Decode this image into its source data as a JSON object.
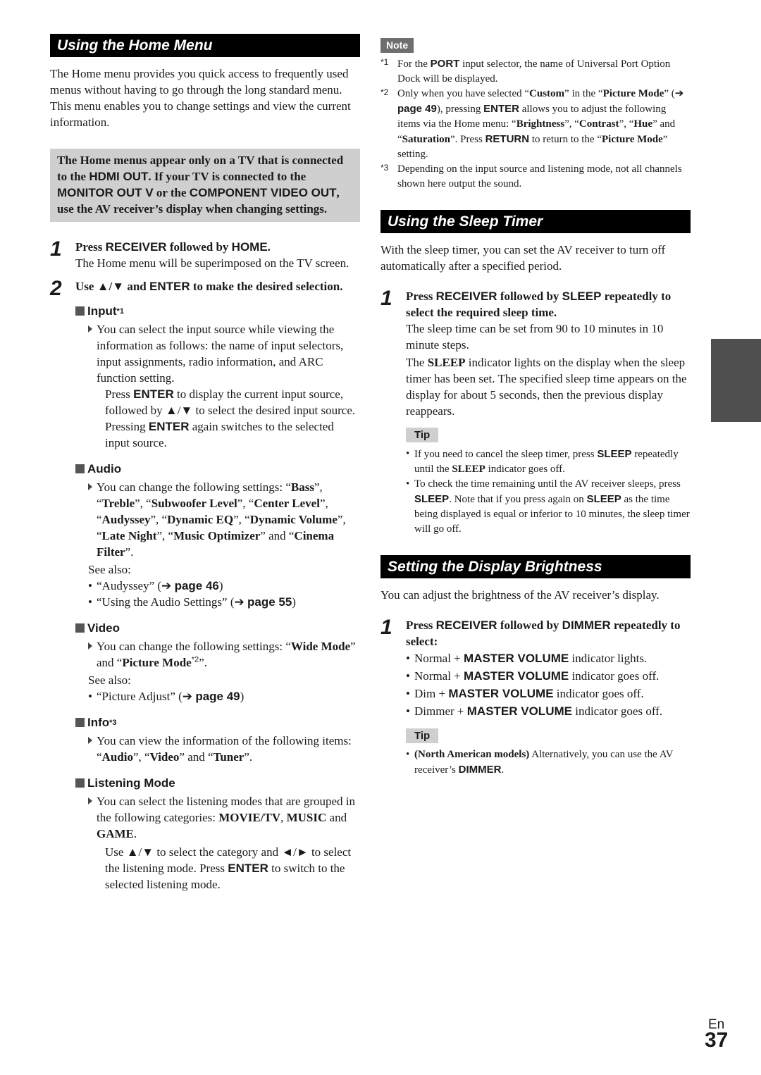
{
  "home_menu": {
    "title": "Using the Home Menu",
    "intro": "The Home menu provides you quick access to frequently used menus without having to go through the long standard menu. This menu enables you to change settings and view the current information.",
    "warning": [
      {
        "t": "The Home menus appear only on a TV that is connected to the "
      },
      {
        "t": "HDMI OUT",
        "s": "bs"
      },
      {
        "t": ". If your TV is connected to the "
      },
      {
        "t": "MONITOR OUT V",
        "s": "bs"
      },
      {
        "t": " or the "
      },
      {
        "t": "COMPONENT VIDEO OUT",
        "s": "bs"
      },
      {
        "t": ", use the AV receiver’s display when changing settings."
      }
    ],
    "step1": {
      "number": "1",
      "title": [
        {
          "t": "Press "
        },
        {
          "t": "RECEIVER",
          "s": "bs"
        },
        {
          "t": " followed by "
        },
        {
          "t": "HOME",
          "s": "bs"
        },
        {
          "t": "."
        }
      ],
      "body": "The Home menu will be superimposed on the TV screen."
    },
    "step2": {
      "number": "2",
      "title": [
        {
          "t": "Use ▲/▼ and "
        },
        {
          "t": "ENTER",
          "s": "bs"
        },
        {
          "t": " to make the desired selection."
        }
      ]
    },
    "input": {
      "heading": "Input",
      "footnote_ref": "*1",
      "desc": "You can select the input source while viewing the information as follows: the name of input selectors, input assignments, radio information, and ARC function setting.",
      "detail": [
        {
          "t": "Press "
        },
        {
          "t": "ENTER",
          "s": "bs"
        },
        {
          "t": " to display the current input source, followed by ▲/▼ to select the desired input source. Pressing "
        },
        {
          "t": "ENTER",
          "s": "bs"
        },
        {
          "t": " again switches to the selected input source."
        }
      ]
    },
    "audio": {
      "heading": "Audio",
      "desc": [
        {
          "t": "You can change the following settings: “"
        },
        {
          "t": "Bass",
          "s": "b"
        },
        {
          "t": "”, “"
        },
        {
          "t": "Treble",
          "s": "b"
        },
        {
          "t": "”, “"
        },
        {
          "t": "Subwoofer Level",
          "s": "b"
        },
        {
          "t": "”, “"
        },
        {
          "t": "Center Level",
          "s": "b"
        },
        {
          "t": "”, “"
        },
        {
          "t": "Audyssey",
          "s": "b"
        },
        {
          "t": "”, “"
        },
        {
          "t": "Dynamic EQ",
          "s": "b"
        },
        {
          "t": "”, “"
        },
        {
          "t": "Dynamic Volume",
          "s": "b"
        },
        {
          "t": "”, “"
        },
        {
          "t": "Late Night",
          "s": "b"
        },
        {
          "t": "”, “"
        },
        {
          "t": "Music Optimizer",
          "s": "b"
        },
        {
          "t": "” and “"
        },
        {
          "t": "Cinema Filter",
          "s": "b"
        },
        {
          "t": "”."
        }
      ],
      "see_also_label": "See also:",
      "see_also": [
        [
          {
            "t": "“Audyssey” (➔ "
          },
          {
            "t": "page 46",
            "s": "bs"
          },
          {
            "t": ")"
          }
        ],
        [
          {
            "t": "“Using the Audio Settings” (➔ "
          },
          {
            "t": "page 55",
            "s": "bs"
          },
          {
            "t": ")"
          }
        ]
      ]
    },
    "video": {
      "heading": "Video",
      "desc": [
        {
          "t": "You can change the following settings: “"
        },
        {
          "t": "Wide Mode",
          "s": "b"
        },
        {
          "t": "” and “"
        },
        {
          "t": "Picture Mode",
          "s": "b"
        },
        {
          "t": "*2",
          "s": "fn"
        },
        {
          "t": "”."
        }
      ],
      "see_also_label": "See also:",
      "see_also": [
        [
          {
            "t": "“Picture Adjust” (➔ "
          },
          {
            "t": "page 49",
            "s": "bs"
          },
          {
            "t": ")"
          }
        ]
      ]
    },
    "info": {
      "heading": "Info",
      "footnote_ref": "*3",
      "desc": [
        {
          "t": "You can view the information of the following items: “"
        },
        {
          "t": "Audio",
          "s": "b"
        },
        {
          "t": "”, “"
        },
        {
          "t": "Video",
          "s": "b"
        },
        {
          "t": "” and “"
        },
        {
          "t": "Tuner",
          "s": "b"
        },
        {
          "t": "”."
        }
      ]
    },
    "listening_mode": {
      "heading": "Listening Mode",
      "desc": [
        {
          "t": "You can select the listening modes that are grouped in the following categories: "
        },
        {
          "t": "MOVIE/TV",
          "s": "b"
        },
        {
          "t": ", "
        },
        {
          "t": "MUSIC",
          "s": "b"
        },
        {
          "t": " and "
        },
        {
          "t": "GAME",
          "s": "b"
        },
        {
          "t": "."
        }
      ],
      "detail": [
        {
          "t": "Use ▲/▼ to select the category and ◄/► to select the listening mode. Press "
        },
        {
          "t": "ENTER",
          "s": "bs"
        },
        {
          "t": " to switch to the selected listening mode."
        }
      ]
    }
  },
  "note": {
    "label": "Note",
    "items": [
      {
        "mark": "*1",
        "text": [
          {
            "t": "For the "
          },
          {
            "t": "PORT",
            "s": "bs"
          },
          {
            "t": " input selector, the name of Universal Port Option Dock will be displayed."
          }
        ]
      },
      {
        "mark": "*2",
        "text": [
          {
            "t": "Only when you have selected “"
          },
          {
            "t": "Custom",
            "s": "b"
          },
          {
            "t": "” in the “"
          },
          {
            "t": "Picture Mode",
            "s": "b"
          },
          {
            "t": "” (➔ "
          },
          {
            "t": "page 49",
            "s": "bs"
          },
          {
            "t": "), pressing "
          },
          {
            "t": "ENTER",
            "s": "bs"
          },
          {
            "t": " allows you to adjust the following items via the Home menu: “"
          },
          {
            "t": "Brightness",
            "s": "b"
          },
          {
            "t": "”, “"
          },
          {
            "t": "Contrast",
            "s": "b"
          },
          {
            "t": "”, “"
          },
          {
            "t": "Hue",
            "s": "b"
          },
          {
            "t": "” and “"
          },
          {
            "t": "Saturation",
            "s": "b"
          },
          {
            "t": "”. Press "
          },
          {
            "t": "RETURN",
            "s": "bs"
          },
          {
            "t": " to return to the “"
          },
          {
            "t": "Picture Mode",
            "s": "b"
          },
          {
            "t": "” setting."
          }
        ]
      },
      {
        "mark": "*3",
        "text": [
          {
            "t": "Depending on the input source and listening mode, not all channels shown here output the sound."
          }
        ]
      }
    ]
  },
  "sleep_timer": {
    "title": "Using the Sleep Timer",
    "intro": "With the sleep timer, you can set the AV receiver to turn off automatically after a specified period.",
    "step1": {
      "number": "1",
      "title": [
        {
          "t": "Press "
        },
        {
          "t": "RECEIVER",
          "s": "bs"
        },
        {
          "t": " followed by "
        },
        {
          "t": "SLEEP",
          "s": "bs"
        },
        {
          "t": " repeatedly to select the required sleep time."
        }
      ],
      "body1": "The sleep time can be set from 90 to 10 minutes in 10 minute steps.",
      "body2": [
        {
          "t": "The "
        },
        {
          "t": "SLEEP",
          "s": "b"
        },
        {
          "t": " indicator lights on the display when the sleep timer has been set. The specified sleep time appears on the display for about 5 seconds, then the previous display reappears."
        }
      ]
    },
    "tip": {
      "label": "Tip",
      "items": [
        [
          {
            "t": "If you need to cancel the sleep timer, press "
          },
          {
            "t": "SLEEP",
            "s": "bs"
          },
          {
            "t": " repeatedly until the "
          },
          {
            "t": "SLEEP",
            "s": "b"
          },
          {
            "t": " indicator goes off."
          }
        ],
        [
          {
            "t": "To check the time remaining until the AV receiver sleeps, press "
          },
          {
            "t": "SLEEP",
            "s": "bs"
          },
          {
            "t": ". Note that if you press again on "
          },
          {
            "t": "SLEEP",
            "s": "bs"
          },
          {
            "t": " as the time being displayed is equal or inferior to 10 minutes, the sleep timer will go off."
          }
        ]
      ]
    }
  },
  "display_brightness": {
    "title": "Setting the Display Brightness",
    "intro": "You can adjust the brightness of the AV receiver’s display.",
    "step1": {
      "number": "1",
      "title": [
        {
          "t": "Press "
        },
        {
          "t": "RECEIVER",
          "s": "bs"
        },
        {
          "t": " followed by "
        },
        {
          "t": "DIMMER",
          "s": "bs"
        },
        {
          "t": " repeatedly to select:"
        }
      ],
      "options": [
        [
          {
            "t": "Normal + "
          },
          {
            "t": "MASTER VOLUME",
            "s": "bs"
          },
          {
            "t": " indicator lights."
          }
        ],
        [
          {
            "t": "Normal + "
          },
          {
            "t": "MASTER VOLUME",
            "s": "bs"
          },
          {
            "t": " indicator goes off."
          }
        ],
        [
          {
            "t": "Dim + "
          },
          {
            "t": "MASTER VOLUME",
            "s": "bs"
          },
          {
            "t": " indicator goes off."
          }
        ],
        [
          {
            "t": "Dimmer + "
          },
          {
            "t": "MASTER VOLUME",
            "s": "bs"
          },
          {
            "t": " indicator goes off."
          }
        ]
      ]
    },
    "tip": {
      "label": "Tip",
      "items": [
        [
          {
            "t": "(North American models)",
            "s": "b"
          },
          {
            "t": " Alternatively, you can use the AV receiver’s "
          },
          {
            "t": "DIMMER",
            "s": "bs"
          },
          {
            "t": "."
          }
        ]
      ]
    }
  },
  "footer": {
    "language": "En",
    "page_number": "37"
  },
  "colors": {
    "section_bar": "#000000",
    "warning_box": "#cfcfcf",
    "note_label": "#6e6e6e",
    "tip_label": "#cfcfcf",
    "side_tab": "#4f4f4f"
  }
}
